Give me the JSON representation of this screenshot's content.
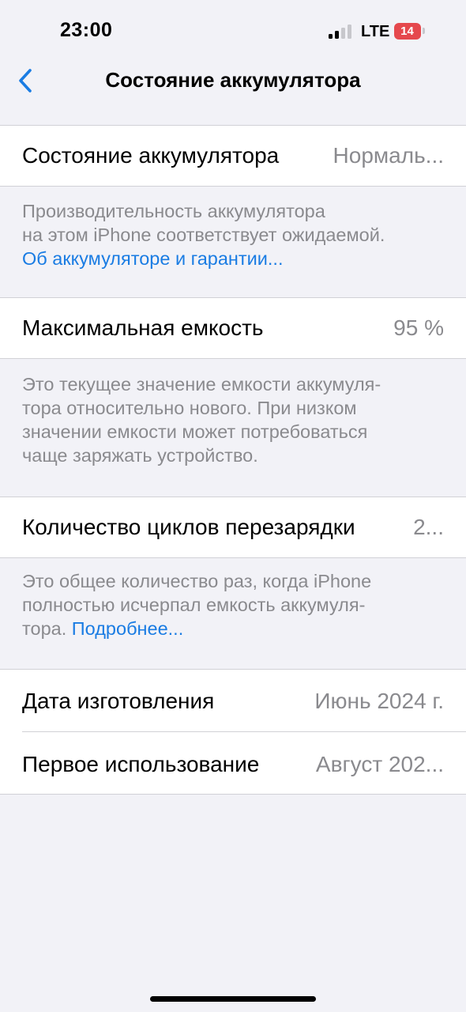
{
  "status_bar": {
    "time": "23:00",
    "network": "LTE",
    "battery": "14"
  },
  "nav": {
    "back_icon": "chevron-left-icon",
    "title": "Состояние аккумулятора"
  },
  "sections": {
    "health": {
      "label": "Состояние аккумулятора",
      "value": "Нормаль...",
      "footnote_lines": [
        "Производительность аккумулятора",
        "на этом iPhone соответствует ожидаемой."
      ],
      "link": "Об аккумуляторе и гарантии..."
    },
    "capacity": {
      "label": "Максимальная емкость",
      "value": "95 %",
      "footnote_lines": [
        "Это текущее значение емкости аккумуля-",
        "тора относительно нового. При низком",
        "значении емкости может потребоваться",
        "чаще заряжать устройство."
      ]
    },
    "cycles": {
      "label": "Количество циклов перезарядки",
      "value": "2...",
      "footnote_lines": [
        "Это общее количество раз, когда iPhone",
        "полностью исчерпал емкость аккумуля-"
      ],
      "footnote_last_prefix": "тора. ",
      "link": "Подробнее..."
    },
    "dates": {
      "manufacture_label": "Дата изготовления",
      "manufacture_value": "Июнь 2024 г.",
      "first_use_label": "Первое использование",
      "first_use_value": "Август 202..."
    }
  },
  "colors": {
    "background": "#F2F2F7",
    "accent": "#1A7CE3",
    "secondary_text": "#8A8A8E",
    "battery_low": "#E5484D"
  }
}
